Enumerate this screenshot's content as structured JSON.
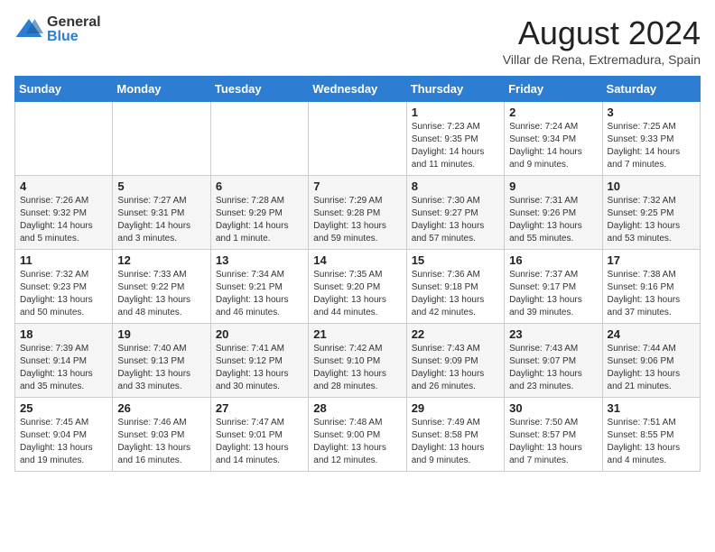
{
  "header": {
    "logo_general": "General",
    "logo_blue": "Blue",
    "month_year": "August 2024",
    "location": "Villar de Rena, Extremadura, Spain"
  },
  "weekdays": [
    "Sunday",
    "Monday",
    "Tuesday",
    "Wednesday",
    "Thursday",
    "Friday",
    "Saturday"
  ],
  "weeks": [
    [
      {
        "day": "",
        "info": ""
      },
      {
        "day": "",
        "info": ""
      },
      {
        "day": "",
        "info": ""
      },
      {
        "day": "",
        "info": ""
      },
      {
        "day": "1",
        "info": "Sunrise: 7:23 AM\nSunset: 9:35 PM\nDaylight: 14 hours\nand 11 minutes."
      },
      {
        "day": "2",
        "info": "Sunrise: 7:24 AM\nSunset: 9:34 PM\nDaylight: 14 hours\nand 9 minutes."
      },
      {
        "day": "3",
        "info": "Sunrise: 7:25 AM\nSunset: 9:33 PM\nDaylight: 14 hours\nand 7 minutes."
      }
    ],
    [
      {
        "day": "4",
        "info": "Sunrise: 7:26 AM\nSunset: 9:32 PM\nDaylight: 14 hours\nand 5 minutes."
      },
      {
        "day": "5",
        "info": "Sunrise: 7:27 AM\nSunset: 9:31 PM\nDaylight: 14 hours\nand 3 minutes."
      },
      {
        "day": "6",
        "info": "Sunrise: 7:28 AM\nSunset: 9:29 PM\nDaylight: 14 hours\nand 1 minute."
      },
      {
        "day": "7",
        "info": "Sunrise: 7:29 AM\nSunset: 9:28 PM\nDaylight: 13 hours\nand 59 minutes."
      },
      {
        "day": "8",
        "info": "Sunrise: 7:30 AM\nSunset: 9:27 PM\nDaylight: 13 hours\nand 57 minutes."
      },
      {
        "day": "9",
        "info": "Sunrise: 7:31 AM\nSunset: 9:26 PM\nDaylight: 13 hours\nand 55 minutes."
      },
      {
        "day": "10",
        "info": "Sunrise: 7:32 AM\nSunset: 9:25 PM\nDaylight: 13 hours\nand 53 minutes."
      }
    ],
    [
      {
        "day": "11",
        "info": "Sunrise: 7:32 AM\nSunset: 9:23 PM\nDaylight: 13 hours\nand 50 minutes."
      },
      {
        "day": "12",
        "info": "Sunrise: 7:33 AM\nSunset: 9:22 PM\nDaylight: 13 hours\nand 48 minutes."
      },
      {
        "day": "13",
        "info": "Sunrise: 7:34 AM\nSunset: 9:21 PM\nDaylight: 13 hours\nand 46 minutes."
      },
      {
        "day": "14",
        "info": "Sunrise: 7:35 AM\nSunset: 9:20 PM\nDaylight: 13 hours\nand 44 minutes."
      },
      {
        "day": "15",
        "info": "Sunrise: 7:36 AM\nSunset: 9:18 PM\nDaylight: 13 hours\nand 42 minutes."
      },
      {
        "day": "16",
        "info": "Sunrise: 7:37 AM\nSunset: 9:17 PM\nDaylight: 13 hours\nand 39 minutes."
      },
      {
        "day": "17",
        "info": "Sunrise: 7:38 AM\nSunset: 9:16 PM\nDaylight: 13 hours\nand 37 minutes."
      }
    ],
    [
      {
        "day": "18",
        "info": "Sunrise: 7:39 AM\nSunset: 9:14 PM\nDaylight: 13 hours\nand 35 minutes."
      },
      {
        "day": "19",
        "info": "Sunrise: 7:40 AM\nSunset: 9:13 PM\nDaylight: 13 hours\nand 33 minutes."
      },
      {
        "day": "20",
        "info": "Sunrise: 7:41 AM\nSunset: 9:12 PM\nDaylight: 13 hours\nand 30 minutes."
      },
      {
        "day": "21",
        "info": "Sunrise: 7:42 AM\nSunset: 9:10 PM\nDaylight: 13 hours\nand 28 minutes."
      },
      {
        "day": "22",
        "info": "Sunrise: 7:43 AM\nSunset: 9:09 PM\nDaylight: 13 hours\nand 26 minutes."
      },
      {
        "day": "23",
        "info": "Sunrise: 7:43 AM\nSunset: 9:07 PM\nDaylight: 13 hours\nand 23 minutes."
      },
      {
        "day": "24",
        "info": "Sunrise: 7:44 AM\nSunset: 9:06 PM\nDaylight: 13 hours\nand 21 minutes."
      }
    ],
    [
      {
        "day": "25",
        "info": "Sunrise: 7:45 AM\nSunset: 9:04 PM\nDaylight: 13 hours\nand 19 minutes."
      },
      {
        "day": "26",
        "info": "Sunrise: 7:46 AM\nSunset: 9:03 PM\nDaylight: 13 hours\nand 16 minutes."
      },
      {
        "day": "27",
        "info": "Sunrise: 7:47 AM\nSunset: 9:01 PM\nDaylight: 13 hours\nand 14 minutes."
      },
      {
        "day": "28",
        "info": "Sunrise: 7:48 AM\nSunset: 9:00 PM\nDaylight: 13 hours\nand 12 minutes."
      },
      {
        "day": "29",
        "info": "Sunrise: 7:49 AM\nSunset: 8:58 PM\nDaylight: 13 hours\nand 9 minutes."
      },
      {
        "day": "30",
        "info": "Sunrise: 7:50 AM\nSunset: 8:57 PM\nDaylight: 13 hours\nand 7 minutes."
      },
      {
        "day": "31",
        "info": "Sunrise: 7:51 AM\nSunset: 8:55 PM\nDaylight: 13 hours\nand 4 minutes."
      }
    ]
  ]
}
